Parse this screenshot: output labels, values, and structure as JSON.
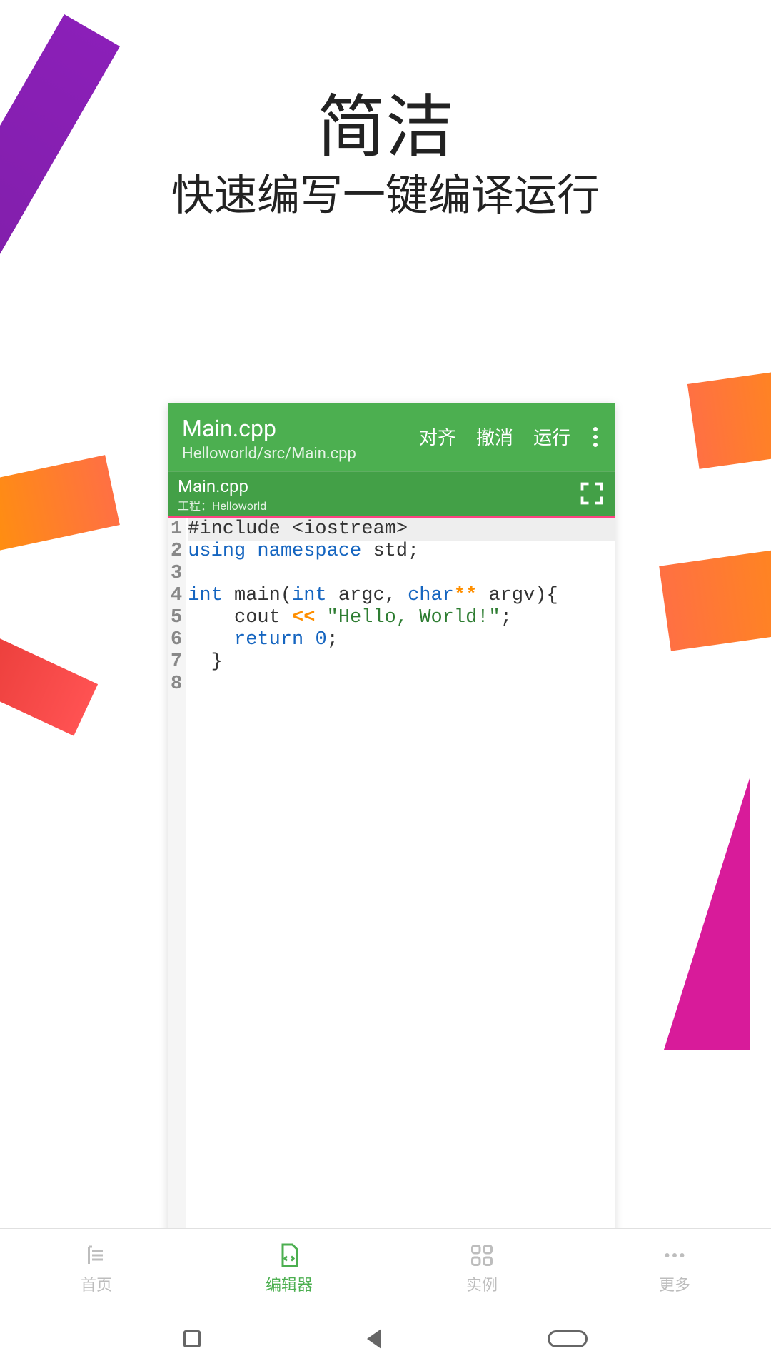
{
  "hero": {
    "title": "简洁",
    "subtitle": "快速编写一键编译运行"
  },
  "editor": {
    "filename": "Main.cpp",
    "filepath": "Helloworld/src/Main.cpp",
    "actions": {
      "align": "对齐",
      "undo": "撤消",
      "run": "运行"
    },
    "tab": {
      "name": "Main.cpp",
      "project": "工程：Helloworld"
    },
    "code": {
      "line1": "#include <iostream>",
      "line2_kw1": "using",
      "line2_kw2": "namespace",
      "line2_rest": " std;",
      "line4_kw1": "int",
      "line4_mid1": " main(",
      "line4_kw2": "int",
      "line4_mid2": " argc, ",
      "line4_kw3": "char",
      "line4_star": "**",
      "line4_rest": " argv){",
      "line5_pre": "    cout ",
      "line5_op": "<<",
      "line5_sp": " ",
      "line5_str": "\"Hello, World!\"",
      "line5_end": ";",
      "line6_pre": "    ",
      "line6_kw": "return",
      "line6_sp": " ",
      "line6_num": "0",
      "line6_end": ";",
      "line7": "  }"
    },
    "gutter": [
      "1",
      "2",
      "3",
      "4",
      "5",
      "6",
      "7",
      "8"
    ]
  },
  "nav": {
    "home": "首页",
    "editor": "编辑器",
    "examples": "实例",
    "more": "更多"
  }
}
